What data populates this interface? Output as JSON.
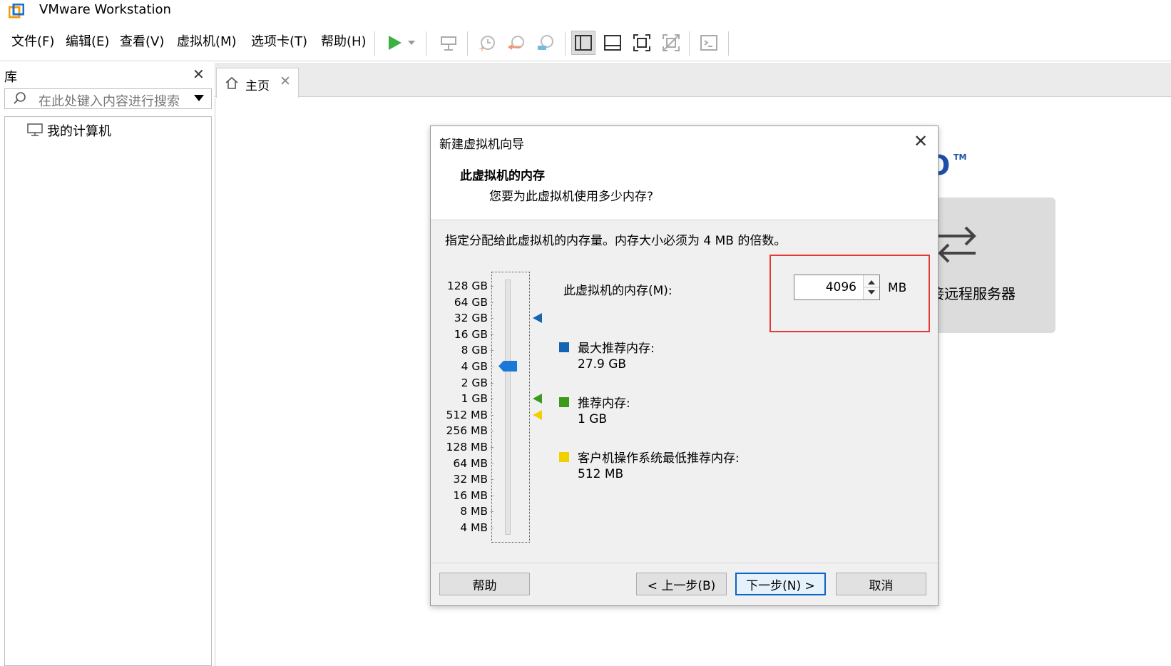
{
  "window": {
    "title": "VMware Workstation"
  },
  "menu": [
    "文件(F)",
    "编辑(E)",
    "查看(V)",
    "虚拟机(M)",
    "选项卡(T)",
    "帮助(H)"
  ],
  "library": {
    "title": "库",
    "search_placeholder": "在此处键入内容进行搜索",
    "tree": [
      {
        "label": "我的计算机"
      }
    ]
  },
  "tabs": [
    {
      "label": "主页"
    }
  ],
  "background": {
    "remote_label": "接远程服务器",
    "tm": "TM"
  },
  "dialog": {
    "title": "新建虚拟机向导",
    "heading": "此虚拟机的内存",
    "subheading": "您要为此虚拟机使用多少内存?",
    "description": "指定分配给此虚拟机的内存量。内存大小必须为 4 MB 的倍数。",
    "memory_label": "此虚拟机的内存(M):",
    "memory_value": "4096",
    "memory_unit": "MB",
    "scale_ticks": [
      "128 GB",
      "64 GB",
      "32 GB",
      "16 GB",
      "8 GB",
      "4 GB",
      "2 GB",
      "1 GB",
      "512 MB",
      "256 MB",
      "128 MB",
      "64 MB",
      "32 MB",
      "16 MB",
      "8 MB",
      "4 MB"
    ],
    "selected_tick": "4 GB",
    "legend": [
      {
        "label": "最大推荐内存:",
        "value": "27.9 GB",
        "color": "#1464b4",
        "tick": "32 GB"
      },
      {
        "label": "推荐内存:",
        "value": "1 GB",
        "color": "#3a9a1a",
        "tick": "1 GB"
      },
      {
        "label": "客户机操作系统最低推荐内存:",
        "value": "512 MB",
        "color": "#f2d000",
        "tick": "512 MB"
      }
    ],
    "buttons": {
      "help": "帮助",
      "back": "< 上一步(B)",
      "next": "下一步(N) >",
      "cancel": "取消"
    }
  },
  "colors": {
    "accent": "#0a64c8",
    "highlight": "#e53935",
    "play": "#3cb043"
  }
}
